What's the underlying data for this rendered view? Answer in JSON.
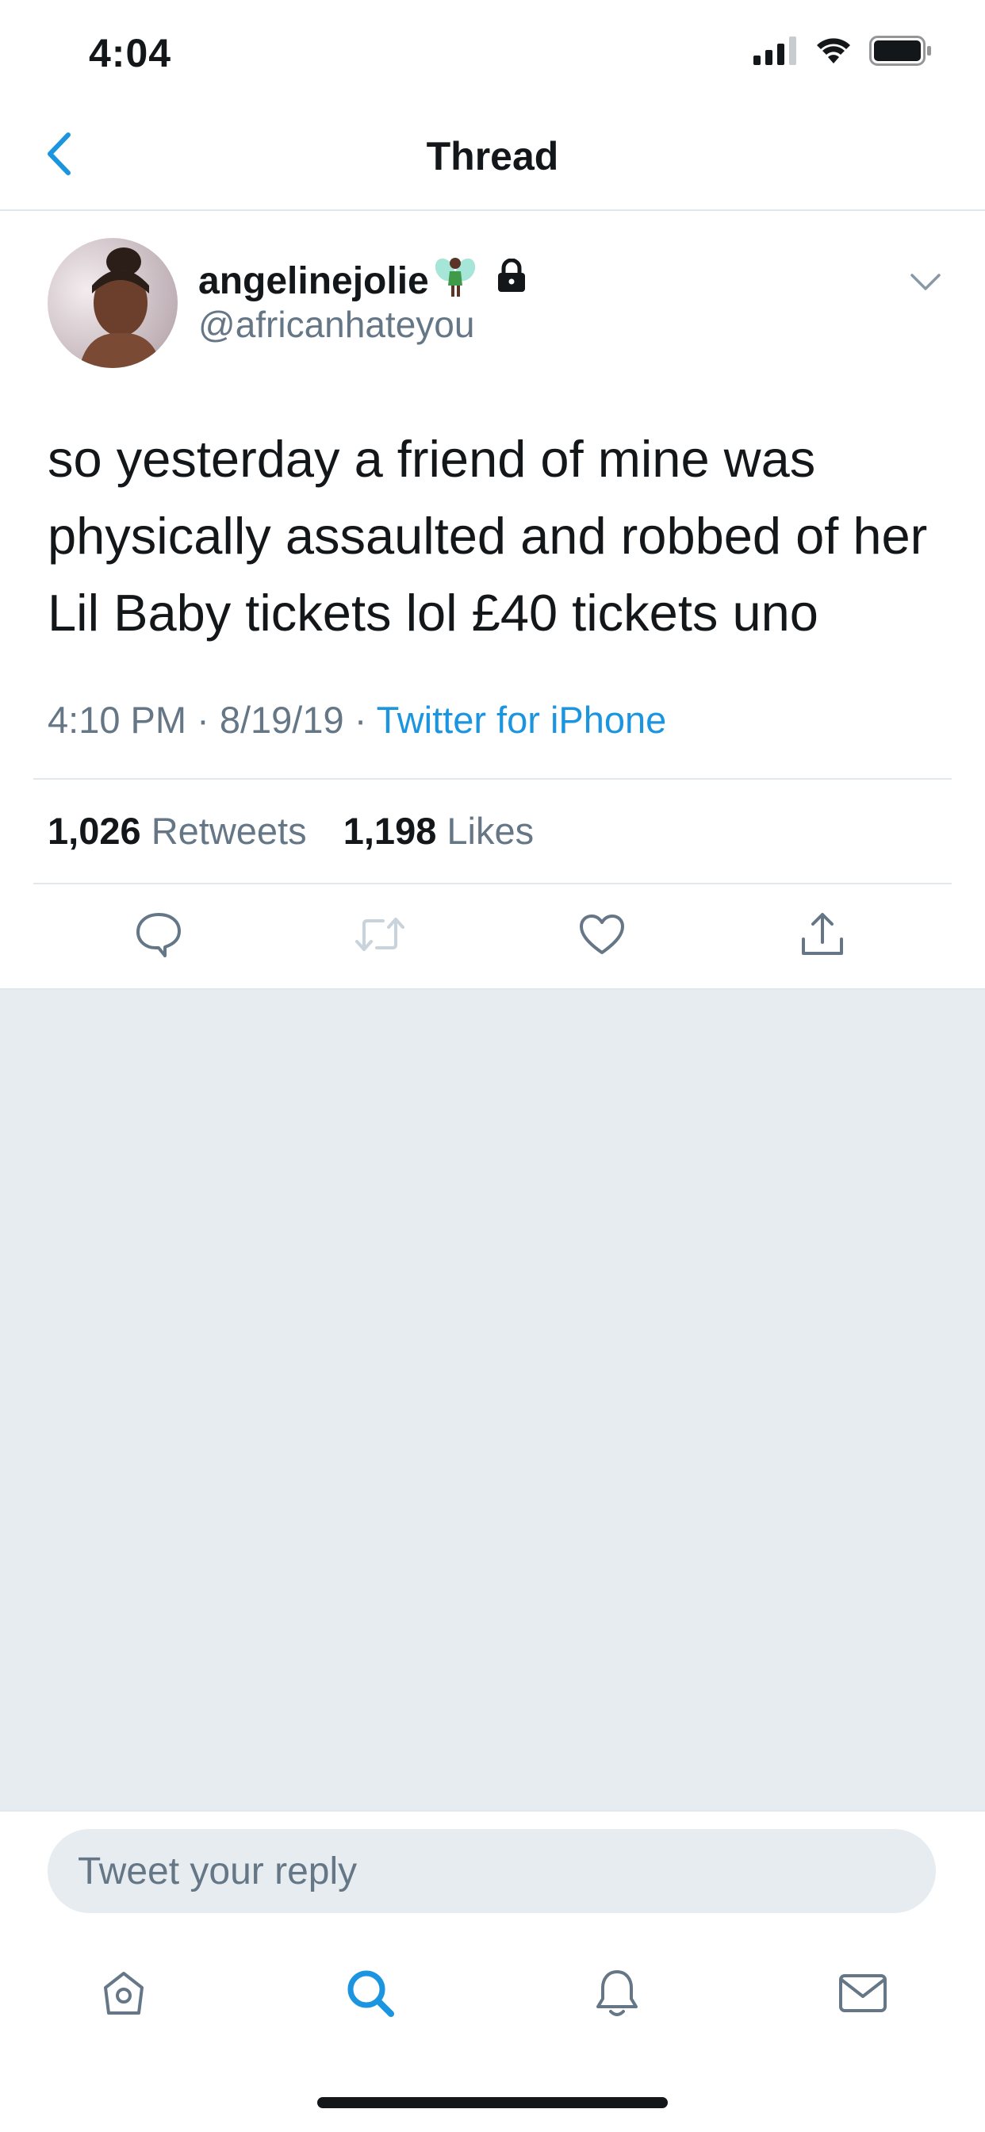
{
  "status_bar": {
    "time": "4:04"
  },
  "nav": {
    "title": "Thread"
  },
  "tweet": {
    "display_name": "angelinejolie",
    "handle": "@africanhateyou",
    "text": "so yesterday a friend of mine was physically assaulted and robbed of her Lil Baby tickets lol £40 tickets uno",
    "time": "4:10 PM",
    "date": "8/19/19",
    "source": "Twitter for iPhone",
    "retweets_count": "1,026",
    "retweets_label": "Retweets",
    "likes_count": "1,198",
    "likes_label": "Likes"
  },
  "reply": {
    "placeholder": "Tweet your reply"
  },
  "colors": {
    "accent": "#1b95e0",
    "secondary_text": "#657786",
    "background_gray": "#e6ecf0"
  },
  "icons": {
    "status": [
      "signal-icon",
      "wifi-icon",
      "battery-icon"
    ],
    "actions": [
      "reply-icon",
      "retweet-icon",
      "like-icon",
      "share-icon"
    ],
    "tabs": [
      "home-icon",
      "search-icon",
      "notifications-icon",
      "messages-icon"
    ]
  }
}
